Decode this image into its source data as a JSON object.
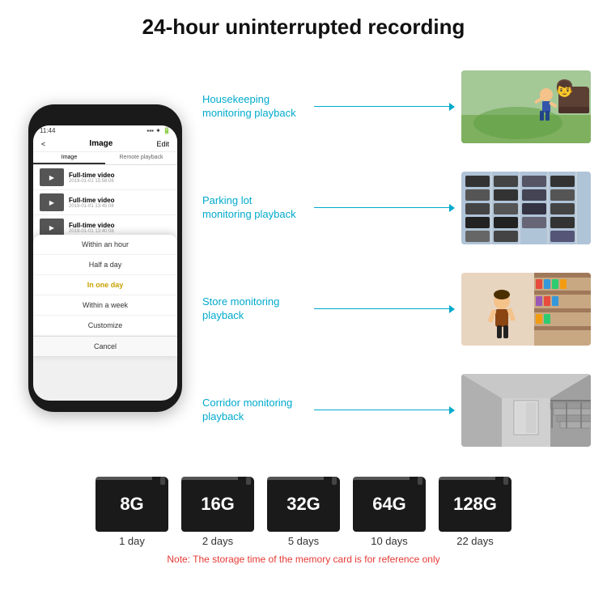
{
  "header": {
    "title": "24-hour uninterrupted recording"
  },
  "phone": {
    "time": "11:44",
    "screen_title": "Image",
    "edit_label": "Edit",
    "back_label": "<",
    "tabs": [
      "Image",
      "Remote playback"
    ],
    "videos": [
      {
        "title": "Full-time video",
        "date": "2019-01-01 15:58:08"
      },
      {
        "title": "Full-time video",
        "date": "2019-01-01 13:45:08"
      },
      {
        "title": "Full-time video",
        "date": "2019-01-01 13:40:08"
      }
    ],
    "dropdown": {
      "items": [
        "Within an hour",
        "Half a day",
        "In one day",
        "Within a week",
        "Customize"
      ],
      "highlighted_index": 2,
      "cancel_label": "Cancel"
    }
  },
  "monitoring": [
    {
      "label": "Housekeeping\nmonitoring playback",
      "image_type": "housekeeping"
    },
    {
      "label": "Parking lot\nmonitoring playback",
      "image_type": "parking"
    },
    {
      "label": "Store monitoring\nplayback",
      "image_type": "store"
    },
    {
      "label": "Corridor monitoring\nplayback",
      "image_type": "corridor"
    }
  ],
  "sdcards": [
    {
      "size": "8G",
      "days": "1 day"
    },
    {
      "size": "16G",
      "days": "2 days"
    },
    {
      "size": "32G",
      "days": "5 days"
    },
    {
      "size": "64G",
      "days": "10 days"
    },
    {
      "size": "128G",
      "days": "22 days"
    }
  ],
  "note": "Note: The storage time of the memory card is for reference only",
  "colors": {
    "accent": "#00aacc",
    "note_red": "#e53935"
  }
}
